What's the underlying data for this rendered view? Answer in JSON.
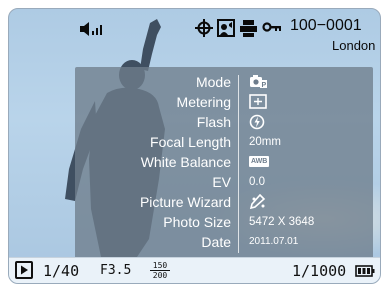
{
  "top": {
    "file_number": "100−0001",
    "location": "London"
  },
  "info": {
    "rows": [
      {
        "label": "Mode",
        "icon": "camera-program-mode-icon"
      },
      {
        "label": "Metering",
        "icon": "metering-spot-icon"
      },
      {
        "label": "Flash",
        "icon": "flash-off-icon"
      },
      {
        "label": "Focal Length",
        "value": "20mm"
      },
      {
        "label": "White Balance",
        "value": "AWB"
      },
      {
        "label": "EV",
        "value": "0.0"
      },
      {
        "label": "Picture Wizard",
        "icon": "picture-wizard-icon"
      },
      {
        "label": "Photo Size",
        "value": "5472 X 3648"
      },
      {
        "label": "Date",
        "value": "2011.07.01"
      }
    ]
  },
  "bottom": {
    "shutter": "1/40",
    "aperture": "F3.5",
    "iso_top": "150",
    "iso_bottom": "200",
    "counter": "1/1000"
  },
  "colors": {
    "panel": "#6e7d8c",
    "sky": "#aecbe4",
    "text_dark": "#0a0a0a",
    "text_light": "#ffffff"
  }
}
